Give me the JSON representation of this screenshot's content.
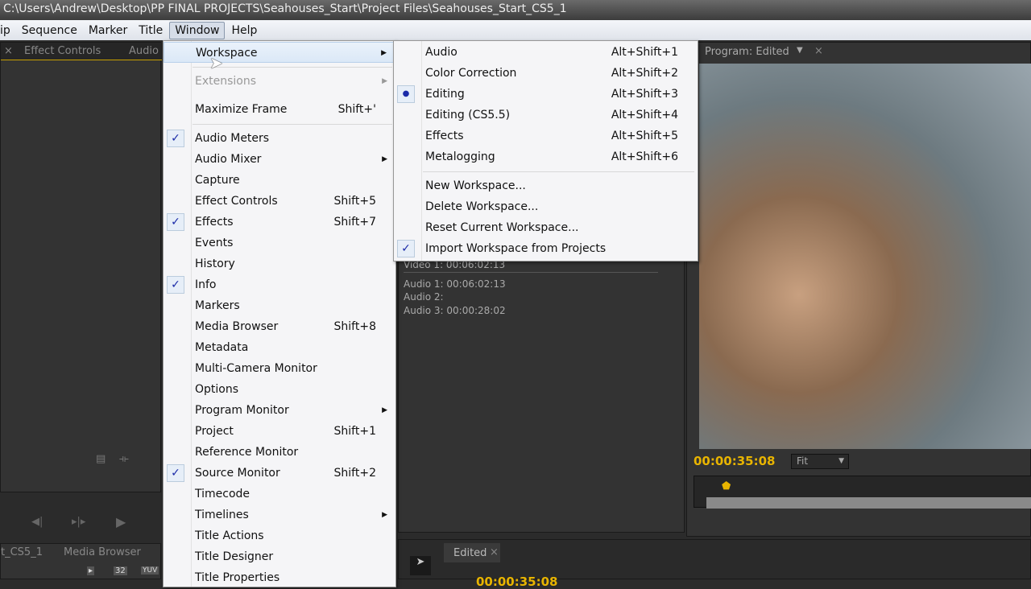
{
  "title": "C:\\Users\\Andrew\\Desktop\\PP FINAL PROJECTS\\Seahouses_Start\\Project Files\\Seahouses_Start_CS5_1",
  "menubar": [
    "ip",
    "Sequence",
    "Marker",
    "Title",
    "Window",
    "Help"
  ],
  "left_tabs": [
    "Effect Controls",
    "Audio"
  ],
  "bottom_tabs": [
    "t_CS5_1",
    "Media Browser"
  ],
  "bottom_icons": [
    "32",
    "YUV"
  ],
  "program": {
    "tab": "Program: Edited",
    "timecode": "00:00:35:08",
    "zoom": "Fit"
  },
  "timeline": {
    "tab": "Edited",
    "timecode": "00:00:35:08"
  },
  "info": {
    "video1": "Video 1:  00:06:02:13",
    "audio1": "Audio 1:  00:06:02:13",
    "audio2": "Audio 2:",
    "audio3": "Audio 3:  00:00:28:02"
  },
  "window_menu": [
    {
      "label": "Workspace",
      "submenu": true,
      "highlighted": true
    },
    {
      "label": "Extensions",
      "submenu": true,
      "disabled": true
    },
    {
      "label": "Maximize Frame",
      "shortcut": "Shift+'"
    },
    {
      "label": "Audio Meters",
      "checked": true
    },
    {
      "label": "Audio Mixer",
      "submenu": true
    },
    {
      "label": "Capture"
    },
    {
      "label": "Effect Controls",
      "shortcut": "Shift+5"
    },
    {
      "label": "Effects",
      "shortcut": "Shift+7",
      "checked": true
    },
    {
      "label": "Events"
    },
    {
      "label": "History"
    },
    {
      "label": "Info",
      "checked": true
    },
    {
      "label": "Markers"
    },
    {
      "label": "Media Browser",
      "shortcut": "Shift+8"
    },
    {
      "label": "Metadata"
    },
    {
      "label": "Multi-Camera Monitor"
    },
    {
      "label": "Options"
    },
    {
      "label": "Program Monitor",
      "submenu": true
    },
    {
      "label": "Project",
      "shortcut": "Shift+1"
    },
    {
      "label": "Reference Monitor"
    },
    {
      "label": "Source Monitor",
      "shortcut": "Shift+2",
      "checked": true
    },
    {
      "label": "Timecode"
    },
    {
      "label": "Timelines",
      "submenu": true
    },
    {
      "label": "Title Actions"
    },
    {
      "label": "Title Designer"
    },
    {
      "label": "Title Properties"
    }
  ],
  "workspace_menu": [
    {
      "label": "Audio",
      "shortcut": "Alt+Shift+1"
    },
    {
      "label": "Color Correction",
      "shortcut": "Alt+Shift+2"
    },
    {
      "label": "Editing",
      "shortcut": "Alt+Shift+3",
      "selected": true
    },
    {
      "label": "Editing (CS5.5)",
      "shortcut": "Alt+Shift+4"
    },
    {
      "label": "Effects",
      "shortcut": "Alt+Shift+5"
    },
    {
      "label": "Metalogging",
      "shortcut": "Alt+Shift+6"
    },
    {
      "label": "New Workspace..."
    },
    {
      "label": "Delete Workspace..."
    },
    {
      "label": "Reset Current Workspace..."
    },
    {
      "label": "Import Workspace from Projects",
      "checked": true
    }
  ],
  "colors": {
    "timecode": "#e8b400",
    "check": "#1a2aa8"
  }
}
